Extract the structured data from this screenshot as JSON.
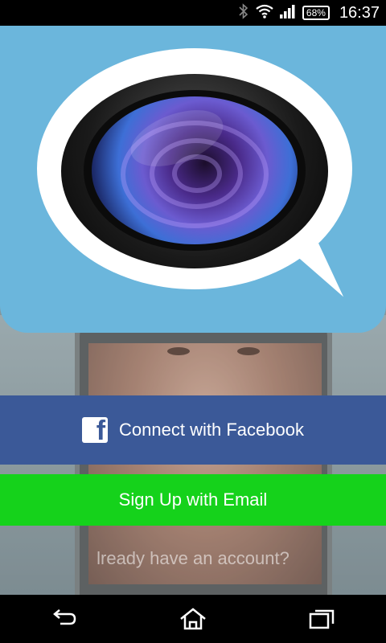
{
  "status_bar": {
    "battery": "68%",
    "time": "16:37",
    "icons": [
      "bluetooth-icon",
      "wifi-icon",
      "signal-icon",
      "battery-icon"
    ]
  },
  "logo": {
    "icon": "camera-lens-chat-bubble-icon",
    "background_color": "#6bb6dc"
  },
  "buttons": {
    "facebook_label": "Connect with Facebook",
    "facebook_icon": "facebook-icon",
    "facebook_color": "#3b5998",
    "email_label": "Sign Up with Email",
    "email_color": "#15d21b"
  },
  "footer": {
    "login_text": "lready have an account?"
  },
  "nav_bar": {
    "icons": [
      "back-icon",
      "home-icon",
      "recent-apps-icon"
    ]
  }
}
